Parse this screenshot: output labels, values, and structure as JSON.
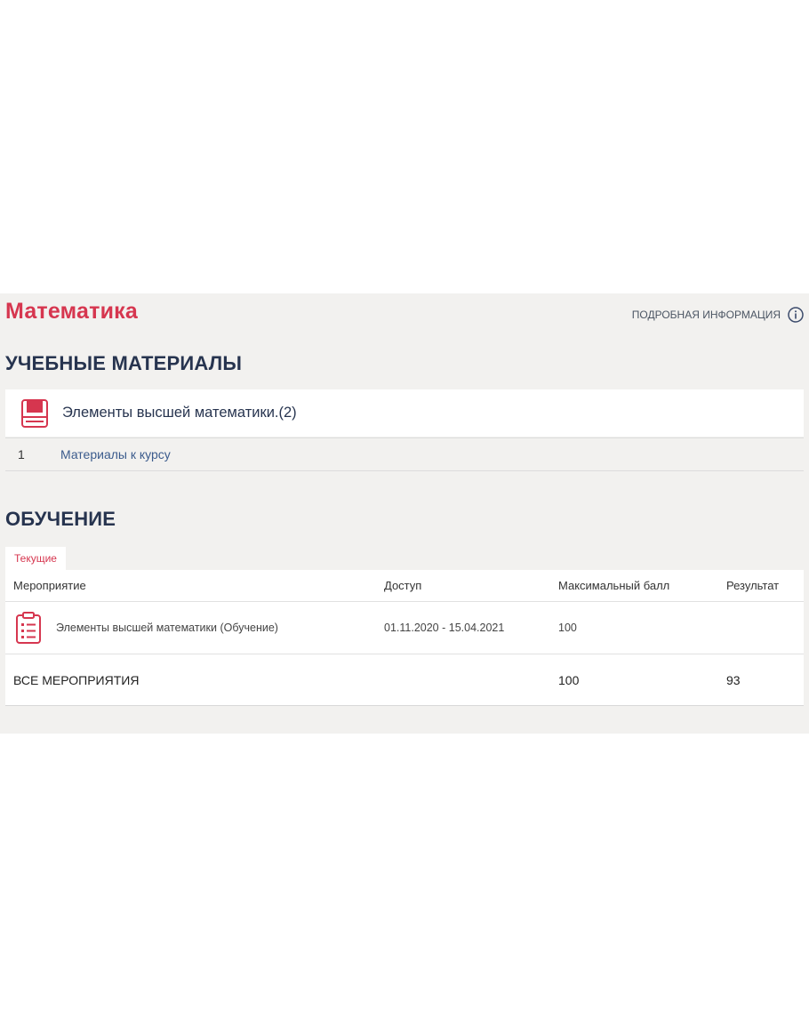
{
  "course": {
    "title": "Математика",
    "info_link": "ПОДРОБНАЯ ИНФОРМАЦИЯ"
  },
  "materials": {
    "heading": "УЧЕБНЫЕ МАТЕРИАЛЫ",
    "group_title": "Элементы высшей математики.(2)",
    "items": [
      {
        "number": "1",
        "label": "Материалы к курсу"
      }
    ]
  },
  "learning": {
    "heading": "ОБУЧЕНИЕ",
    "tab": "Текущие",
    "columns": [
      "Мероприятие",
      "Доступ",
      "Максимальный балл",
      "Результат"
    ],
    "rows": [
      {
        "event": "Элементы высшей математики (Обучение)",
        "access": "01.11.2020 - 15.04.2021",
        "max_score": "100",
        "result": ""
      }
    ],
    "total": {
      "label": "ВСЕ МЕРОПРИЯТИЯ",
      "max_score": "100",
      "result": "93"
    }
  },
  "colors": {
    "accent": "#d6364f",
    "heading": "#27344f",
    "link": "#3b5b8c",
    "panel_bg": "#f2f1ef"
  },
  "icons": {
    "info": "info-circle-icon",
    "materials": "book-icon",
    "event": "clipboard-list-icon"
  }
}
